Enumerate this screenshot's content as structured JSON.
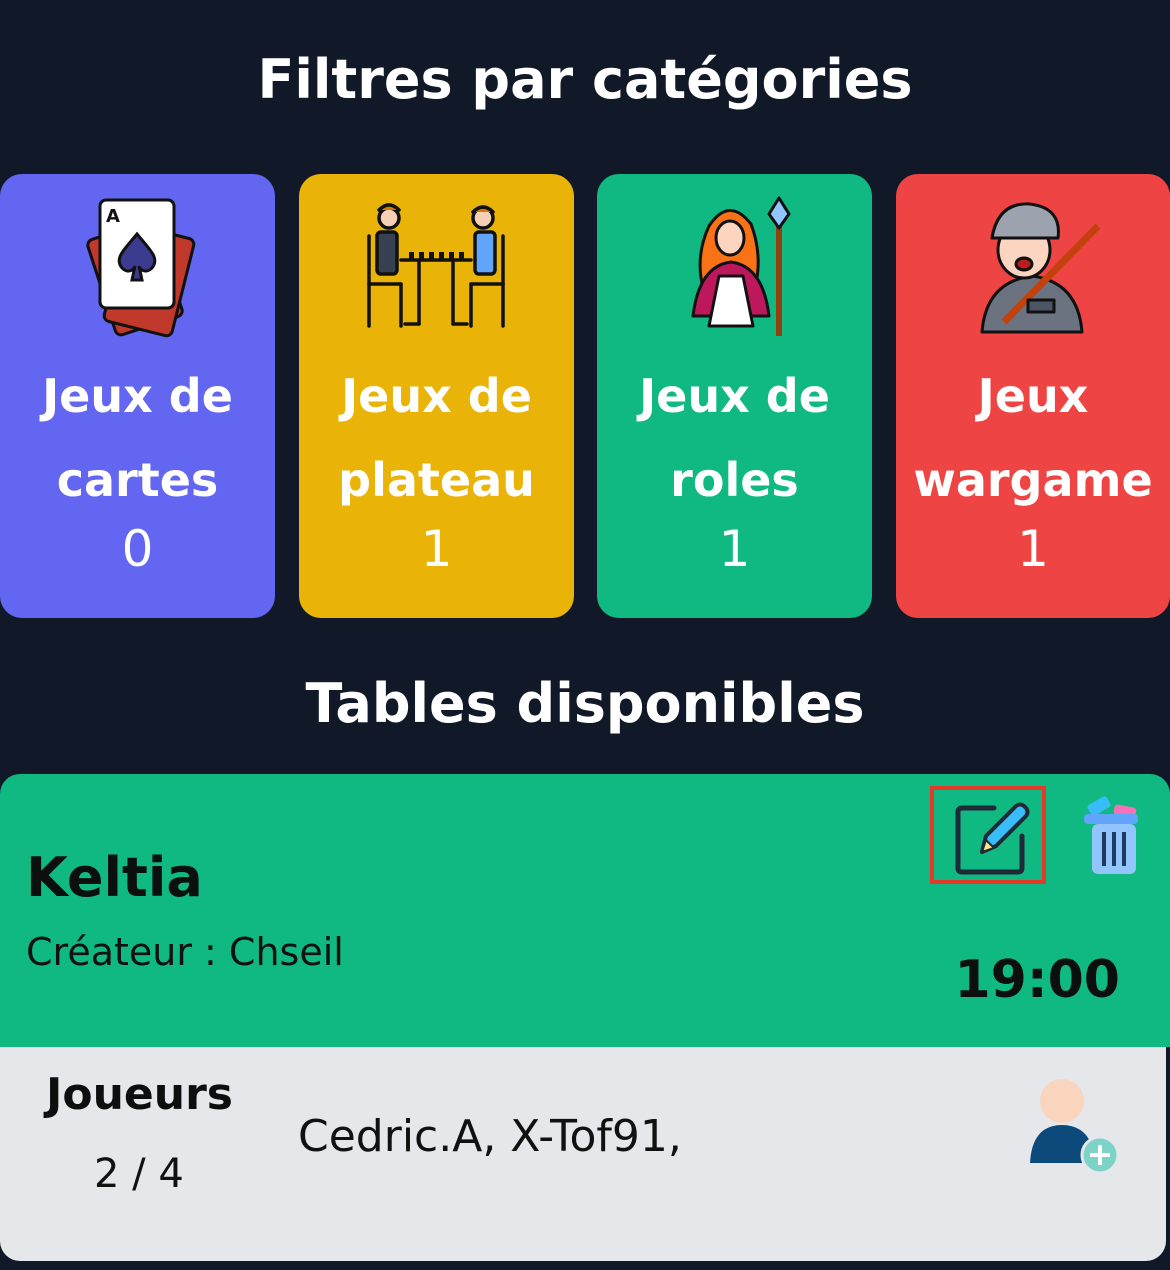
{
  "filters": {
    "title": "Filtres par catégories",
    "categories": [
      {
        "label_line1": "Jeux de",
        "label_line2": "cartes",
        "count": "0",
        "color": "#6366f1",
        "icon": "cards-icon"
      },
      {
        "label_line1": "Jeux de",
        "label_line2": "plateau",
        "count": "1",
        "color": "#eab308",
        "icon": "board-game-players-icon"
      },
      {
        "label_line1": "Jeux de",
        "label_line2": "roles",
        "count": "1",
        "color": "#10b981",
        "icon": "sorceress-icon"
      },
      {
        "label_line1": "Jeux",
        "label_line2": "wargame",
        "count": "1",
        "color": "#ef4444",
        "icon": "soldier-icon"
      }
    ]
  },
  "tables": {
    "title": "Tables disponibles",
    "items": [
      {
        "name": "Keltia",
        "creator": "Créateur : Chseil",
        "time": "19:00",
        "players_label": "Joueurs",
        "players_count": "2 / 4",
        "players": "Cedric.A, X-Tof91,",
        "header_color": "#10b981"
      }
    ]
  }
}
